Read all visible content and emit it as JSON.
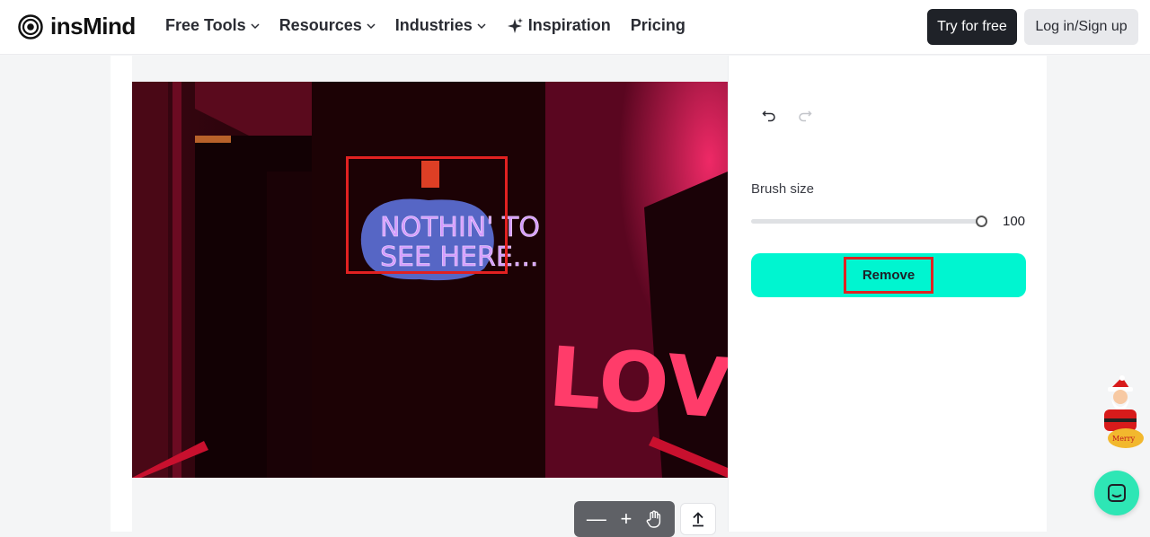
{
  "header": {
    "logo_text": "insMind",
    "nav": [
      {
        "label": "Free Tools",
        "has_dropdown": true
      },
      {
        "label": "Resources",
        "has_dropdown": true
      },
      {
        "label": "Industries",
        "has_dropdown": true
      },
      {
        "label": "Inspiration",
        "icon": "sparkle-icon"
      },
      {
        "label": "Pricing"
      }
    ],
    "try_label": "Try for free",
    "login_label": "Log in/Sign up"
  },
  "image": {
    "sign_line1": "NOTHIN' TO",
    "sign_line2": "SEE HERE...",
    "wall_text": "LOVE"
  },
  "toolbar": {
    "zoom_out": "—",
    "zoom_in": "+",
    "pan_icon": "hand-icon",
    "export_icon": "upload-icon"
  },
  "panel": {
    "undo_icon": "undo-icon",
    "redo_icon": "redo-icon",
    "brush_label": "Brush size",
    "brush_value": "100",
    "brush_level": 1.0,
    "remove_label": "Remove"
  },
  "colors": {
    "accent": "#00f5d0",
    "highlight": "#e12121",
    "dark_button": "#1f2228",
    "chat": "#2ee6b5"
  }
}
